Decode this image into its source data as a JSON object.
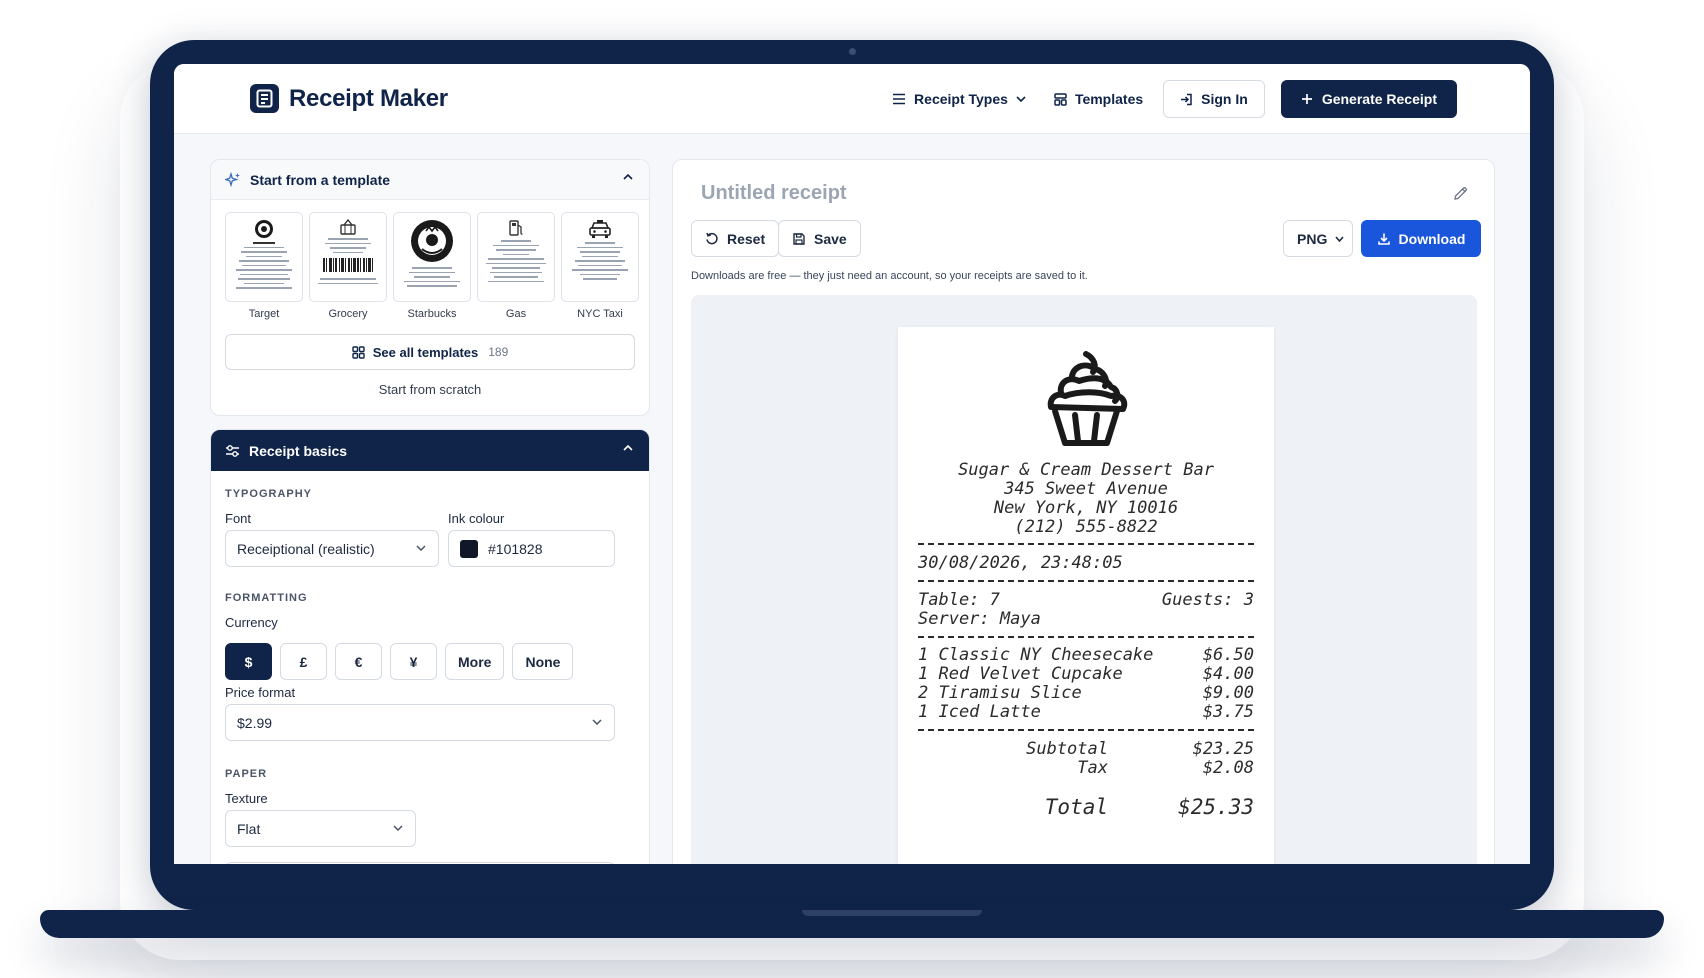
{
  "header": {
    "brand": "Receipt Maker",
    "nav": {
      "receipt_types": "Receipt Types",
      "templates": "Templates",
      "sign_in": "Sign In",
      "generate": "Generate Receipt"
    }
  },
  "templates_panel": {
    "title": "Start from a template",
    "items": [
      {
        "label": "Target"
      },
      {
        "label": "Grocery"
      },
      {
        "label": "Starbucks"
      },
      {
        "label": "Gas"
      },
      {
        "label": "NYC Taxi"
      }
    ],
    "see_all_label": "See all templates",
    "see_all_count": "189",
    "scratch_label": "Start from scratch"
  },
  "basics": {
    "title": "Receipt basics",
    "typography_label": "TYPOGRAPHY",
    "font_label": "Font",
    "font_value": "Receiptional (realistic)",
    "ink_label": "Ink colour",
    "ink_value": "#101828",
    "formatting_label": "FORMATTING",
    "currency_label": "Currency",
    "currencies": [
      "$",
      "£",
      "€",
      "¥",
      "More",
      "None"
    ],
    "currency_selected": "$",
    "price_format_label": "Price format",
    "price_format_value": "$2.99",
    "paper_label": "PAPER",
    "texture_label": "Texture",
    "texture_value": "Flat"
  },
  "preview": {
    "title": "Untitled receipt",
    "reset_label": "Reset",
    "save_label": "Save",
    "format_value": "PNG",
    "download_label": "Download",
    "note": "Downloads are free — they just need an account, so your receipts are saved to it."
  },
  "receipt": {
    "business_name": "Sugar & Cream Dessert Bar",
    "address_line1": "345 Sweet Avenue",
    "address_line2": "New York, NY 10016",
    "phone": "(212) 555-8822",
    "datetime": "30/08/2026, 23:48:05",
    "table": "Table: 7",
    "guests": "Guests: 3",
    "server": "Server: Maya",
    "items": [
      {
        "desc": "1 Classic NY Cheesecake",
        "price": "$6.50"
      },
      {
        "desc": "1 Red Velvet Cupcake",
        "price": "$4.00"
      },
      {
        "desc": "2 Tiramisu Slice",
        "price": "$9.00"
      },
      {
        "desc": "1 Iced Latte",
        "price": "$3.75"
      }
    ],
    "subtotal_label": "Subtotal",
    "subtotal_value": "$23.25",
    "tax_label": "Tax",
    "tax_value": "$2.08",
    "total_label": "Total",
    "total_value": "$25.33"
  },
  "colors": {
    "navy": "#0f2448",
    "accent_blue": "#1a56db",
    "ink": "#101828"
  }
}
